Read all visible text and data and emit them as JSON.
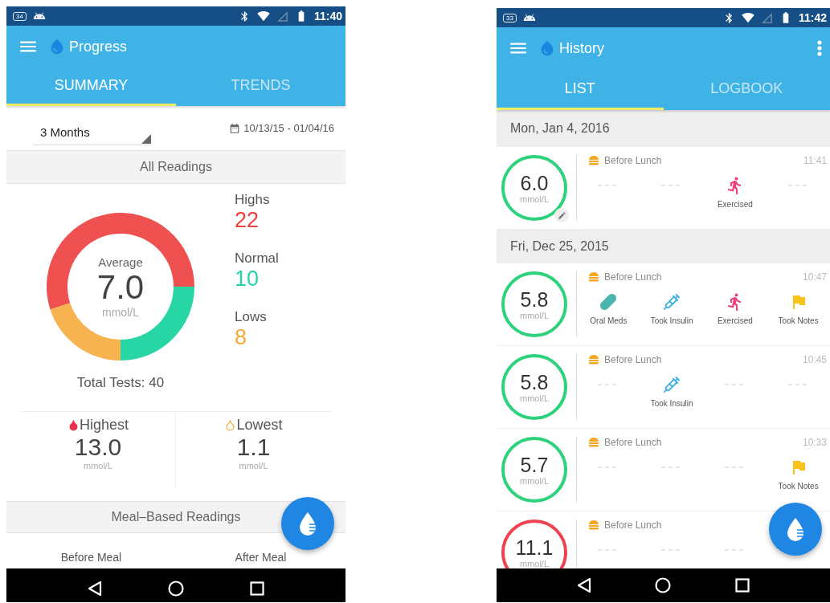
{
  "progress_screen": {
    "status_bar": {
      "notification_count": "34",
      "time": "11:40"
    },
    "app_bar": {
      "title": "Progress"
    },
    "tabs": [
      {
        "label": "SUMMARY",
        "selected": true
      },
      {
        "label": "TRENDS",
        "selected": false
      }
    ],
    "period_dropdown": {
      "value": "3 Months"
    },
    "date_range": "10/13/15 - 01/04/16",
    "all_readings": {
      "title": "All Readings",
      "average": {
        "label": "Average",
        "value": "7.0",
        "unit": "mmol/L"
      },
      "chart_data": {
        "type": "donut",
        "categories": [
          "Highs",
          "Normal",
          "Lows"
        ],
        "values": [
          55,
          25,
          20
        ],
        "colors": [
          "#ef5050",
          "#27d6a4",
          "#f7b34f"
        ]
      },
      "total_tests": "Total Tests: 40",
      "stats": [
        {
          "value": "22",
          "color": "#ef4040"
        },
        {
          "value": "10",
          "color": "#25d4a8"
        },
        {
          "value": "8",
          "color": "#f5a93a"
        }
      ]
    },
    "extremes": [
      {
        "kind": "highest",
        "label": "Highest",
        "value": "13.0",
        "unit": "mmol/L"
      },
      {
        "kind": "lowest",
        "label": "Lowest",
        "value": "1.1",
        "unit": "mmol/L"
      }
    ],
    "meal_based": {
      "title": "Meal–Based Readings",
      "columns": [
        "Before Meal",
        "After Meal"
      ]
    }
  },
  "history_screen": {
    "status_bar": {
      "notification_count": "33",
      "time": "11:42"
    },
    "app_bar": {
      "title": "History"
    },
    "tabs": [
      {
        "label": "LIST",
        "selected": true
      },
      {
        "label": "LOGBOOK",
        "selected": false
      }
    ],
    "days": [
      {
        "date": "Mon, Jan 4, 2016",
        "entries": [
          {
            "value": "6.0",
            "unit": "mmol/L",
            "color": "#2fd27c",
            "edited": true,
            "meal": "Before Lunch",
            "time": "11:41",
            "slots": [
              {
                "kind": "empty"
              },
              {
                "kind": "empty"
              },
              {
                "kind": "exercise",
                "label": "Exercised"
              },
              {
                "kind": "empty"
              }
            ]
          }
        ]
      },
      {
        "date": "Fri, Dec 25, 2015",
        "entries": [
          {
            "value": "5.8",
            "unit": "mmol/L",
            "color": "#2fd27c",
            "edited": false,
            "meal": "Before Lunch",
            "time": "10:47",
            "slots": [
              {
                "kind": "oral_meds",
                "label": "Oral Meds"
              },
              {
                "kind": "insulin",
                "label": "Took Insulin"
              },
              {
                "kind": "exercise",
                "label": "Exercised"
              },
              {
                "kind": "notes",
                "label": "Took Notes"
              }
            ]
          },
          {
            "value": "5.8",
            "unit": "mmol/L",
            "color": "#2fd27c",
            "edited": false,
            "meal": "Before Lunch",
            "time": "10:45",
            "slots": [
              {
                "kind": "empty"
              },
              {
                "kind": "insulin",
                "label": "Took Insulin"
              },
              {
                "kind": "empty"
              },
              {
                "kind": "empty"
              }
            ]
          },
          {
            "value": "5.7",
            "unit": "mmol/L",
            "color": "#2fd27c",
            "edited": false,
            "meal": "Before Lunch",
            "time": "10:33",
            "slots": [
              {
                "kind": "empty"
              },
              {
                "kind": "empty"
              },
              {
                "kind": "empty"
              },
              {
                "kind": "notes",
                "label": "Took Notes"
              }
            ]
          },
          {
            "value": "11.1",
            "unit": "mmol/L",
            "color": "#ee4250",
            "edited": false,
            "meal": "Before Lunch",
            "slots": [
              {
                "kind": "empty"
              },
              {
                "kind": "empty"
              },
              {
                "kind": "empty"
              }
            ]
          }
        ]
      }
    ]
  }
}
